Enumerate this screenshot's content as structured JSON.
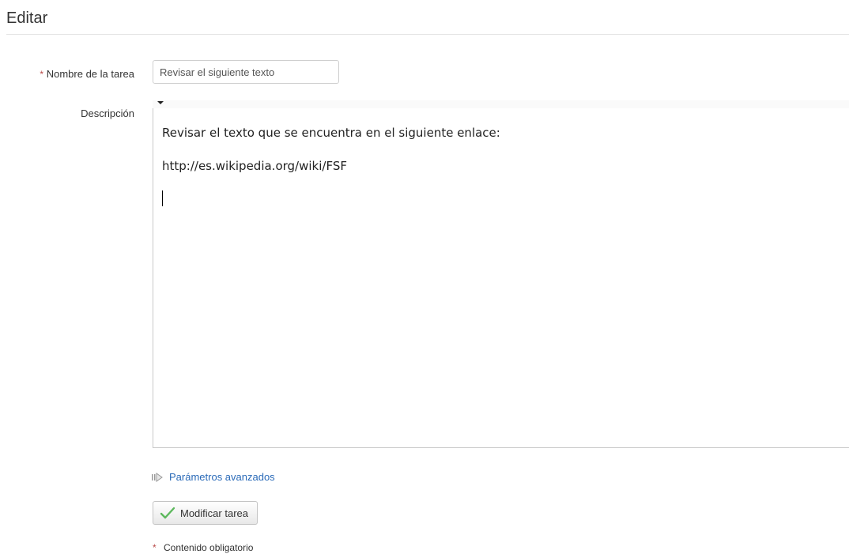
{
  "page": {
    "title": "Editar"
  },
  "form": {
    "required_marker": "*",
    "name_label": "Nombre de la tarea",
    "name_value": "Revisar el siguiente texto",
    "description_label": "Descripción",
    "description_lines": [
      "Revisar el texto que se encuentra en el siguiente enlace:",
      "http://es.wikipedia.org/wiki/FSF"
    ],
    "advanced_link": "Parámetros avanzados",
    "submit_label": "Modificar tarea",
    "required_note": "Contenido obligatorio"
  },
  "colors": {
    "required": "#b94a48",
    "link": "#2a6ab8",
    "check": "#5cb85c"
  },
  "icons": {
    "advanced": "arrow-right-icon",
    "submit": "checkmark-icon",
    "toolbar": "caret-down-icon"
  }
}
